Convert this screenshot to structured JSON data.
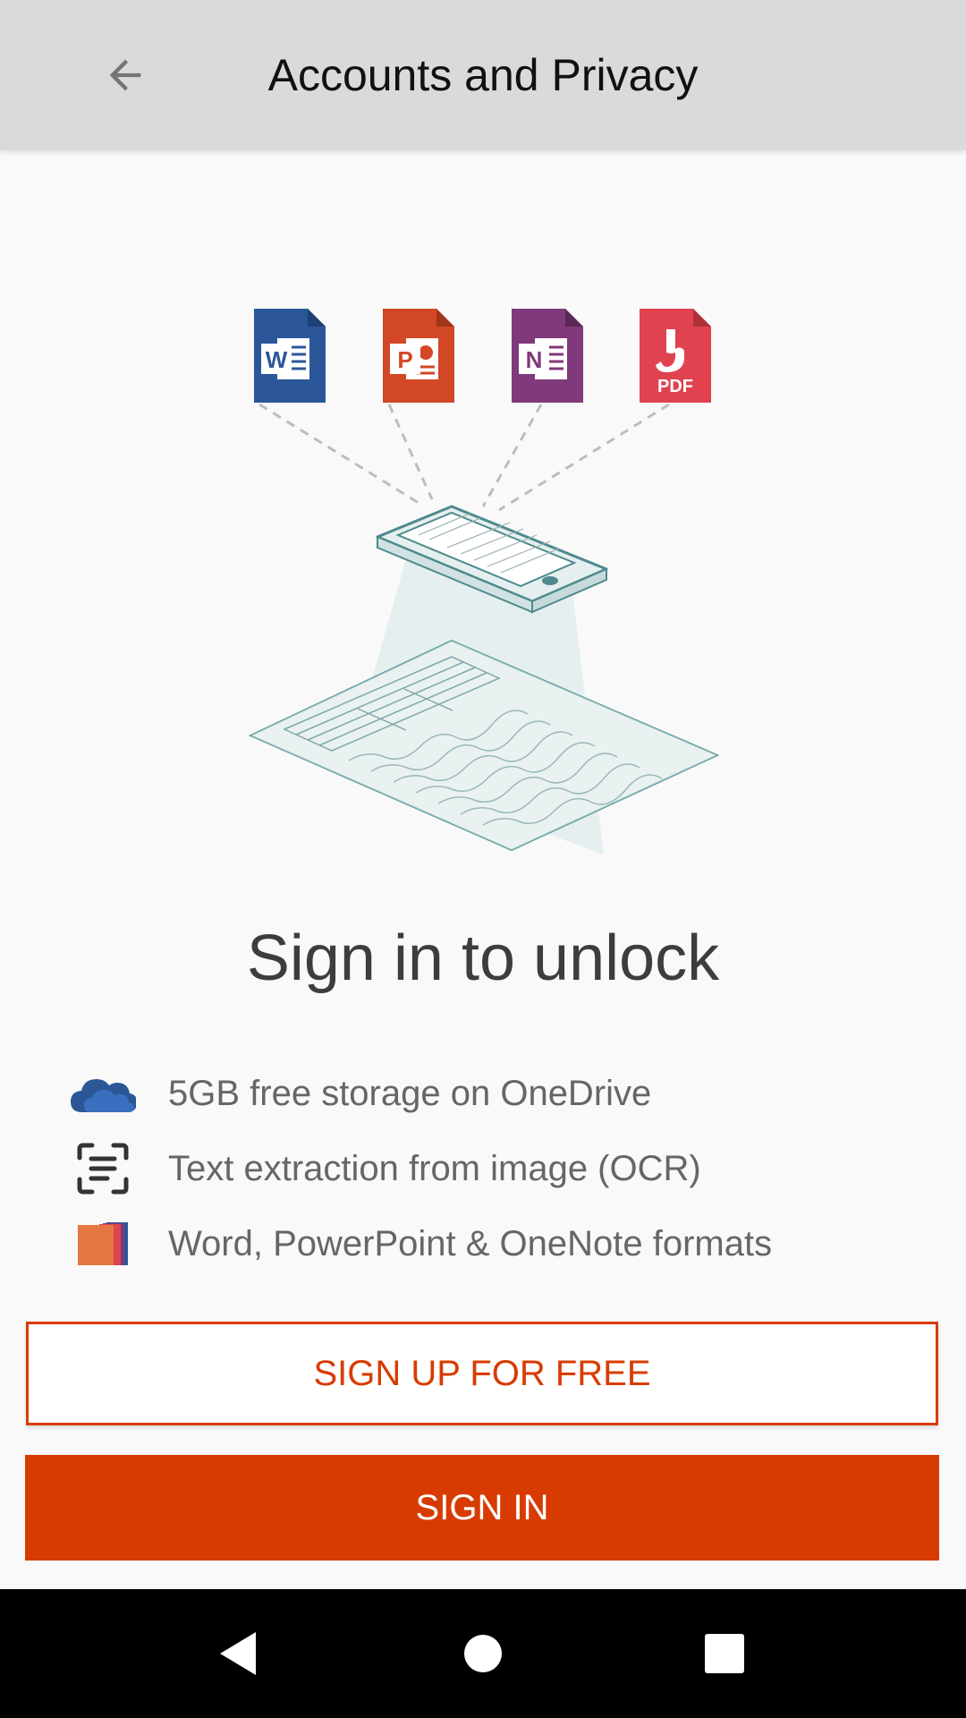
{
  "appbar": {
    "title": "Accounts and Privacy",
    "back_icon": "arrow-back-icon"
  },
  "hero": {
    "app_icons": [
      {
        "name": "word-file-icon",
        "letter": "W",
        "color": "#2b579a"
      },
      {
        "name": "powerpoint-file-icon",
        "letter": "P",
        "color": "#d24726"
      },
      {
        "name": "onenote-file-icon",
        "letter": "N",
        "color": "#80397b"
      },
      {
        "name": "pdf-file-icon",
        "letter": "PDF",
        "color": "#e0434f"
      }
    ]
  },
  "headline": "Sign in to unlock",
  "features": [
    {
      "icon": "onedrive-cloud-icon",
      "text": "5GB free storage on OneDrive"
    },
    {
      "icon": "ocr-scan-icon",
      "text": "Text extraction from image (OCR)"
    },
    {
      "icon": "office-formats-icon",
      "text": "Word, PowerPoint & OneNote formats"
    }
  ],
  "buttons": {
    "signup_label": "SIGN UP FOR FREE",
    "signin_label": "SIGN IN"
  },
  "navbar": {
    "back_icon": "nav-back-icon",
    "home_icon": "nav-home-icon",
    "recents_icon": "nav-recents-icon"
  },
  "colors": {
    "accent": "#d83b01",
    "appbar_bg": "#dadada",
    "page_bg": "#f9f9f9",
    "onedrive_blue": "#2b5797"
  }
}
